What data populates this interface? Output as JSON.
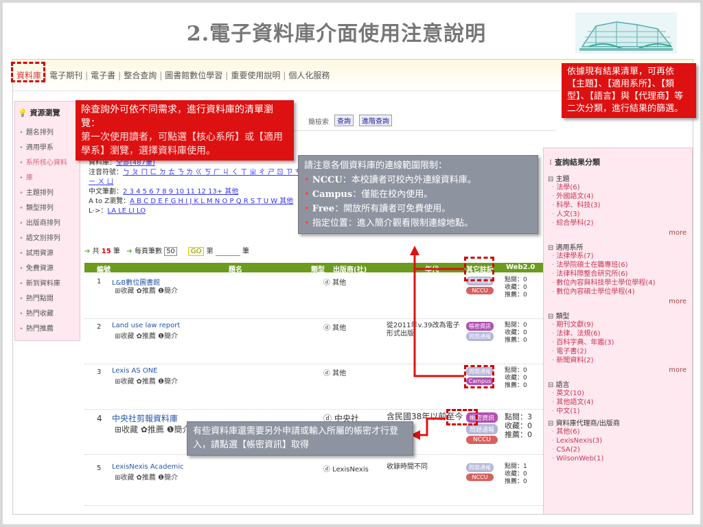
{
  "slide": {
    "title": "2.電子資料庫介面使用注意說明"
  },
  "nav": {
    "items": [
      "資料庫",
      "電子期刊",
      "電子書",
      "整合查詢",
      "圖書館數位學習",
      "重要使用說明",
      "個人化服務"
    ]
  },
  "left_panel": {
    "head": "資源瀏覽",
    "items": [
      "題名排列",
      "適用學系",
      "系所核心資料",
      "庫",
      "主題排列",
      "類型排列",
      "出版商排列",
      "語文別排列",
      "試用資源",
      "免費資源",
      "新到資料庫",
      "熱門點閱",
      "熱門收藏",
      "熱門推薦"
    ]
  },
  "search": {
    "label": "簡檢索",
    "button": "查詢",
    "advanced": "進階查詢"
  },
  "browse": {
    "line1": "資料庫：",
    "line1_link": "全部(487筆)",
    "zhuyin_label": "注音符號：",
    "zhuyin_links": "ㄅ ㄆ ㄇ ㄈ ㄉ ㄊ ㄋ ㄌ ㄍ ㄎ ㄏ ㄐ ㄑ ㄒ ㄓ ㄔ ㄕ ㄖ ㄗ ㄘ ㄙ ㄧ ㄨ ㄩ",
    "stroke_label": "中文筆劃：",
    "stroke_links": "2 3 4 5 6 7 8 9 10 11 12 13+ 其他",
    "az_label": "A to Z瀏覽：",
    "az_links": "A B C D E F G H I J K L M N O P Q R S T U W 其他",
    "lc_label": "L->：",
    "lc_links": "LA LE LI LO"
  },
  "count_bar": {
    "prefix": "共",
    "count": "15",
    "suffix": "筆",
    "per_page_label": "每頁筆數",
    "per_page": "50",
    "go": "GO",
    "page_prefix": "第",
    "page_suffix": "筆"
  },
  "table": {
    "headers": [
      "編號",
      "題名",
      "類型",
      "出版商(社)",
      "年代",
      "其它註記",
      "Web2.0"
    ],
    "rows": [
      {
        "idx": "1",
        "name": "L&B數位圖書館",
        "actions": "⊞收藏 ✿推薦 ❶簡介",
        "source": "ⓓ 其他",
        "year": "",
        "tags": [
          "問題通報",
          "NCCU"
        ],
        "web": [
          "點閱：0",
          "收藏：0",
          "推薦：0"
        ]
      },
      {
        "idx": "2",
        "name": "Land use law report",
        "actions": "⊞收藏 ✿推薦 ❶簡介",
        "source": "ⓓ 其他",
        "year": "從2011年v.39改為電子形式出版",
        "tags": [
          "帳密資訊",
          "問題通報"
        ],
        "web": [
          "點閱：0",
          "收藏：0",
          "推薦：0"
        ]
      },
      {
        "idx": "3",
        "name": "Lexis AS ONE",
        "actions": "⊞收藏 ✿推薦 ❶簡介",
        "source": "ⓓ 其他",
        "year": "",
        "tags": [
          "問題通報",
          "Campus"
        ],
        "web": [
          "點閱：0",
          "收藏：0",
          "推薦：0"
        ]
      },
      {
        "idx": "4",
        "name": "中央社剪報資料庫",
        "actions": "⊞收藏 ✿推薦 ❶簡介",
        "source": "ⓓ 中央社",
        "year": "含民國38年以前至今",
        "tags": [
          "帳密資訊",
          "問題通報",
          "NCCU"
        ],
        "web": [
          "點閱：3",
          "收藏：0",
          "推薦：0"
        ]
      },
      {
        "idx": "5",
        "name": "LexisNexis Academic",
        "actions": "⊞收藏 ✿推薦 ❶簡介",
        "source": "ⓓ LexisNexis",
        "year": "收錄時間不同",
        "tags": [
          "問題通報",
          "NCCU"
        ],
        "web": [
          "點閱：1",
          "收藏：0",
          "推薦：0"
        ]
      }
    ]
  },
  "right_panel": {
    "title": "查詢結果分類",
    "more": "more",
    "sections": [
      {
        "head": "主題",
        "items": [
          "法學(6)",
          "外國語文(4)",
          "科學、科技(3)",
          "人文(3)",
          "綜合學科(2)"
        ]
      },
      {
        "head": "適用系所",
        "items": [
          "法律學系(7)",
          "法學院碩士在職專班(6)",
          "法律科際整合研究所(6)",
          "數位內容與科技學士學位學程(4)",
          "數位內容碩士學位學程(4)"
        ]
      },
      {
        "head": "類型",
        "items": [
          "期刊文獻(9)",
          "法律、法規(6)",
          "百科字典、年鑑(3)",
          "電子書(2)",
          "新聞資料(2)"
        ]
      },
      {
        "head": "語言",
        "items": [
          "英文(10)",
          "其他語文(4)",
          "中文(1)"
        ]
      },
      {
        "head": "資料庫代理商/出版商",
        "items": [
          "其他(6)",
          "LexisNexis(3)",
          "CSA(2)",
          "WilsonWeb(1)"
        ]
      }
    ]
  },
  "callouts": {
    "browse_title": "除查詢外可依不同需求，進行資料庫的清單瀏覽：",
    "browse_body": "第一次使用讀者，可點選【核心系所】或【適用學系】瀏覽，選擇資料庫使用。",
    "filter": "依據現有結果清單，可再依【主題】、【適用系所】、【類型】、【語言】與【代理商】等二次分類，進行結果的篩選。",
    "range_title": "請注意各個資料庫的連線範圍限制：",
    "range_items": [
      {
        "en": "NCCU",
        "zh": "：本校讀者可校內外連線資料庫。"
      },
      {
        "en": "Campus",
        "zh": "：僅能在校內使用。"
      },
      {
        "en": "Free",
        "zh": "：開放所有讀者可免費使用。"
      },
      {
        "en": "",
        "zh": "指定位置：進入簡介觀看限制連線地點。"
      }
    ],
    "account": "有些資料庫還需要另外申請或輸入所屬的帳密才行登入，請點選【帳密資訊】取得"
  },
  "colors": {
    "callout_red": "#dd1111",
    "callout_gray": "#8e93a0",
    "header_green": "#6b9b1f",
    "panel_pink": "#fde9ef"
  }
}
